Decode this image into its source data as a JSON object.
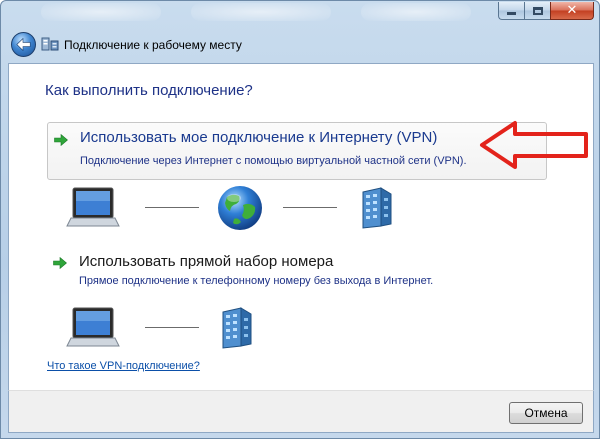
{
  "window": {
    "title": "Подключение к рабочему месту"
  },
  "content": {
    "question": "Как выполнить подключение?",
    "options": [
      {
        "title": "Использовать мое подключение к Интернету (VPN)",
        "description": "Подключение через Интернет с помощью виртуальной частной сети (VPN)."
      },
      {
        "title": "Использовать прямой набор номера",
        "description": "Прямое подключение к телефонному номеру без выхода в Интернет."
      }
    ],
    "help_link": "Что такое VPN-подключение?"
  },
  "footer": {
    "cancel_label": "Отмена"
  },
  "icons": {
    "back": "back-arrow-icon",
    "wizard": "network-connection-icon",
    "option_arrow": "green-arrow-icon",
    "computer": "computer-icon",
    "globe": "globe-internet-icon",
    "server": "office-building-icon",
    "annotation": "red-outline-arrow-icon"
  },
  "colors": {
    "accent_text": "#1e3287",
    "option_arrow": "#2fa53a",
    "annotation_arrow": "#e3231b",
    "link": "#0b4fa8"
  }
}
